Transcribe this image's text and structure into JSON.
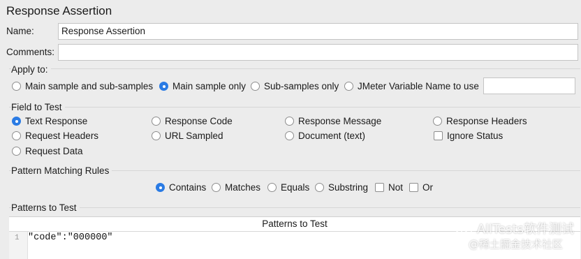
{
  "header": {
    "title": "Response Assertion"
  },
  "name_row": {
    "label": "Name:",
    "value": "Response Assertion"
  },
  "comments_row": {
    "label": "Comments:",
    "value": ""
  },
  "apply_to": {
    "label": "Apply to:",
    "options": [
      {
        "label": "Main sample and sub-samples",
        "selected": false
      },
      {
        "label": "Main sample only",
        "selected": true
      },
      {
        "label": "Sub-samples only",
        "selected": false
      },
      {
        "label": "JMeter Variable Name to use",
        "selected": false
      }
    ],
    "variable_value": ""
  },
  "field_to_test": {
    "label": "Field to Test",
    "options": [
      {
        "label": "Text Response",
        "selected": true
      },
      {
        "label": "Response Code",
        "selected": false
      },
      {
        "label": "Response Message",
        "selected": false
      },
      {
        "label": "Response Headers",
        "selected": false
      },
      {
        "label": "Request Headers",
        "selected": false
      },
      {
        "label": "URL Sampled",
        "selected": false
      },
      {
        "label": "Document (text)",
        "selected": false
      },
      {
        "label": "Request Data",
        "selected": false
      }
    ],
    "ignore_status": {
      "label": "Ignore Status",
      "checked": false
    }
  },
  "pattern_matching": {
    "label": "Pattern Matching Rules",
    "options": [
      {
        "label": "Contains",
        "selected": true
      },
      {
        "label": "Matches",
        "selected": false
      },
      {
        "label": "Equals",
        "selected": false
      },
      {
        "label": "Substring",
        "selected": false
      }
    ],
    "not": {
      "label": "Not",
      "checked": false
    },
    "or": {
      "label": "Or",
      "checked": false
    }
  },
  "patterns": {
    "label": "Patterns to Test",
    "column_header": "Patterns to Test",
    "rows": [
      {
        "line": "1",
        "text": "\"code\":\"000000\""
      }
    ]
  },
  "watermark": {
    "text": "AllTests软件测试",
    "sub": "@稀土掘金技术社区"
  }
}
